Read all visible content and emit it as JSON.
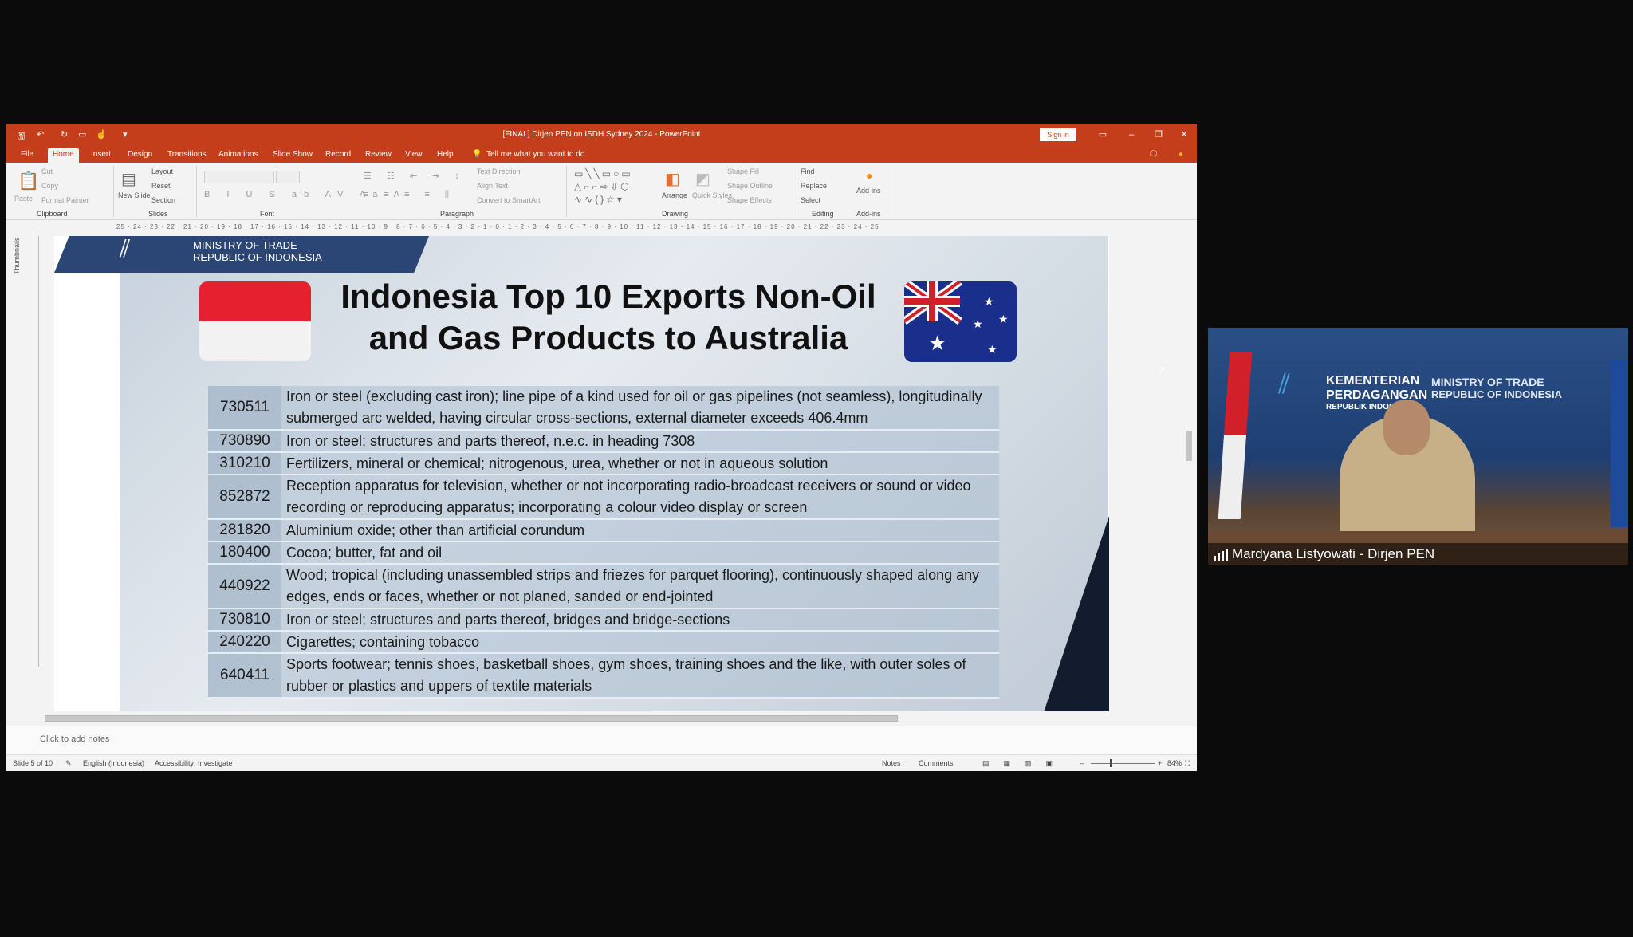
{
  "window": {
    "title": "[FINAL] Dirjen PEN on ISDH Sydney 2024 - PowerPoint",
    "sign_in": "Sign in",
    "accent": "#c43e1c"
  },
  "tabs": [
    "File",
    "Home",
    "Insert",
    "Design",
    "Transitions",
    "Animations",
    "Slide Show",
    "Record",
    "Review",
    "View",
    "Help"
  ],
  "tell_me": "Tell me what you want to do",
  "ribbon": {
    "clipboard": {
      "paste": "Paste",
      "cut": "Cut",
      "copy": "Copy",
      "format_painter": "Format Painter",
      "label": "Clipboard"
    },
    "slides": {
      "new_slide": "New Slide",
      "layout": "Layout",
      "reset": "Reset",
      "section": "Section",
      "label": "Slides"
    },
    "font": {
      "label": "Font"
    },
    "paragraph": {
      "text_direction": "Text Direction",
      "align_text": "Align Text",
      "convert": "Convert to SmartArt",
      "label": "Paragraph"
    },
    "drawing": {
      "arrange": "Arrange",
      "quick_styles": "Quick Styles",
      "shape_fill": "Shape Fill",
      "shape_outline": "Shape Outline",
      "shape_effects": "Shape Effects",
      "label": "Drawing"
    },
    "editing": {
      "find": "Find",
      "replace": "Replace",
      "select": "Select",
      "label": "Editing"
    },
    "addins": {
      "addins": "Add-ins",
      "label": "Add-ins"
    }
  },
  "ruler_text": "25 · 24 · 23 · 22 · 21 · 20 · 19 · 18 · 17 · 16 · 15 · 14 · 13 · 12 · 11 · 10 · 9 · 8 · 7 · 6 · 5 · 4 · 3 · 2 · 1 · 0 · 1 · 2 · 3 · 4 · 5 · 6 · 7 · 8 · 9 · 10 · 11 · 12 · 13 · 14 · 15 · 16 · 17 · 18 · 19 · 20 · 21 · 22 · 23 · 24 · 25",
  "thumbnails_label": "Thumbnails",
  "slide": {
    "ministry_line1": "MINISTRY OF TRADE",
    "ministry_line2": "REPUBLIC OF INDONESIA",
    "title_line1": "Indonesia Top 10 Exports Non-Oil",
    "title_line2": "and Gas Products to Australia",
    "rows": [
      {
        "code": "730511",
        "desc": "Iron or steel (excluding cast iron); line pipe of a kind used for oil or gas pipelines (not seamless), longitudinally submerged arc welded, having circular cross-sections, external diameter exceeds 406.4mm"
      },
      {
        "code": "730890",
        "desc": "Iron or steel; structures and parts thereof, n.e.c. in heading 7308"
      },
      {
        "code": "310210",
        "desc": "Fertilizers, mineral or chemical; nitrogenous, urea, whether or not in aqueous solution"
      },
      {
        "code": "852872",
        "desc": "Reception apparatus for television, whether or not incorporating radio-broadcast receivers or sound or video recording or reproducing apparatus; incorporating a colour video display or screen"
      },
      {
        "code": "281820",
        "desc": "Aluminium oxide; other than artificial corundum"
      },
      {
        "code": "180400",
        "desc": "Cocoa; butter, fat and oil"
      },
      {
        "code": "440922",
        "desc": "Wood; tropical (including unassembled strips and friezes for parquet flooring), continuously shaped along any edges, ends or faces, whether or not planed, sanded or end-jointed"
      },
      {
        "code": "730810",
        "desc": "Iron or steel; structures and parts thereof, bridges and bridge-sections"
      },
      {
        "code": "240220",
        "desc": "Cigarettes; containing tobacco"
      },
      {
        "code": "640411",
        "desc": "Sports footwear; tennis shoes, basketball shoes, gym shoes, training shoes and the like, with outer soles of rubber or plastics and uppers of textile materials"
      }
    ]
  },
  "notes_placeholder": "Click to add notes",
  "status": {
    "slide_count": "Slide 5 of 10",
    "language": "English (Indonesia)",
    "accessibility": "Accessibility: Investigate",
    "notes": "Notes",
    "comments": "Comments",
    "zoom": "84%"
  },
  "video": {
    "logo_line1": "KEMENTERIAN",
    "logo_line2": "PERDAGANGAN",
    "logo_line3": "REPUBLIK INDONESIA",
    "right_line1": "MINISTRY OF TRADE",
    "right_line2": "REPUBLIC OF INDONESIA",
    "participant_name": "Mardyana Listyowati - Dirjen PEN"
  }
}
